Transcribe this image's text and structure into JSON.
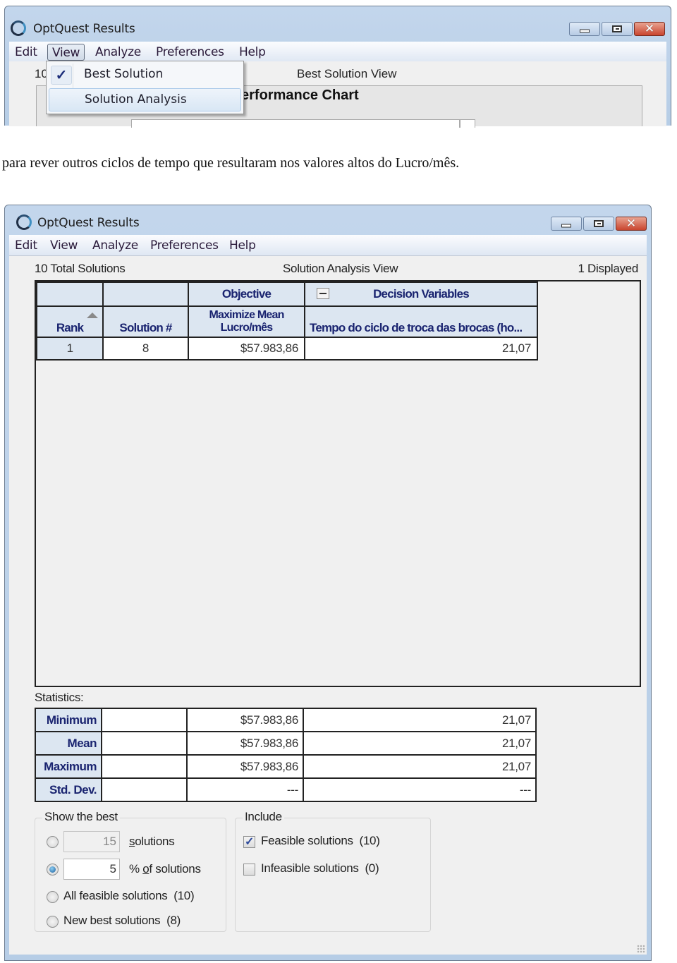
{
  "top_window": {
    "title": "OptQuest Results",
    "menu": [
      "Edit",
      "View",
      "Analyze",
      "Preferences",
      "Help"
    ],
    "open_menu": "View",
    "count_fragment": "10",
    "view_title": "Best Solution View",
    "panel_title_fragment": "erformance Chart",
    "view_menu": {
      "items": [
        {
          "label": "Best Solution",
          "checked": true
        },
        {
          "label": "Solution Analysis",
          "checked": false,
          "hovered": true
        }
      ]
    },
    "check_glyph": "✓"
  },
  "caption": "para rever outros ciclos de tempo que resultaram nos valores altos do Lucro/mês.",
  "window": {
    "title": "OptQuest Results",
    "controls": {
      "minimize": "minimize",
      "maximize": "maximize",
      "close": "✕"
    },
    "menu": [
      "Edit",
      "View",
      "Analyze",
      "Preferences",
      "Help"
    ],
    "header": {
      "total": "10 Total Solutions",
      "view": "Solution Analysis View",
      "displayed": "1 Displayed"
    },
    "results_table": {
      "group_headers": {
        "objective": "Objective",
        "decision_variables": "Decision Variables"
      },
      "columns": [
        "Rank",
        "Solution #",
        "Maximize Mean Lucro/mês",
        "Tempo do ciclo de troca das brocas (ho..."
      ],
      "objective_col_line1": "Maximize Mean",
      "objective_col_line2": "Lucro/mês",
      "sort_column": "Rank",
      "sort_direction": "ascending",
      "rows": [
        {
          "rank": "1",
          "solution": "8",
          "objective": "$57.983,86",
          "variable": "21,07"
        }
      ]
    },
    "statistics": {
      "label": "Statistics:",
      "rows": [
        {
          "name": "Minimum",
          "objective": "$57.983,86",
          "variable": "21,07"
        },
        {
          "name": "Mean",
          "objective": "$57.983,86",
          "variable": "21,07"
        },
        {
          "name": "Maximum",
          "objective": "$57.983,86",
          "variable": "21,07"
        },
        {
          "name": "Std. Dev.",
          "objective": "---",
          "variable": "---"
        }
      ]
    },
    "show_best": {
      "legend": "Show the best",
      "options": [
        {
          "value": "15",
          "label_prefix": "",
          "label_mnemonic": "s",
          "label_rest": "olutions",
          "selected": false,
          "enabled": false
        },
        {
          "value": "5",
          "label_prefix": "% ",
          "label_mnemonic": "o",
          "label_rest": "f solutions",
          "selected": true,
          "enabled": true
        },
        {
          "label": "All feasible solutions  (10)",
          "selected": false
        },
        {
          "label": "New best solutions  (8)",
          "selected": false
        }
      ]
    },
    "include": {
      "legend": "Include",
      "options": [
        {
          "label": "Feasible solutions  (10)",
          "checked": true
        },
        {
          "label": "Infeasible solutions  (0)",
          "checked": false
        }
      ]
    }
  }
}
